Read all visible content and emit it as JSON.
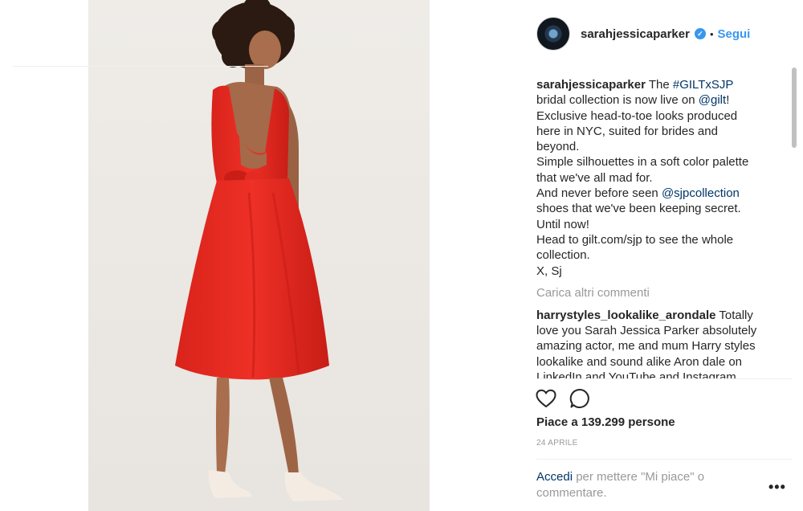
{
  "post": {
    "username": "sarahjessicaparker",
    "verified_mark": "✓",
    "separator": "•",
    "follow_label": "Segui",
    "image_icon": "photo-of-woman-in-red-dress"
  },
  "caption": {
    "username": "sarahjessicaparker",
    "lines": {
      "l1_pre": "The ",
      "hashtag": "#GILTxSJP",
      "l2_pre": "bridal collection is now live on ",
      "mention_gilt": "@gilt",
      "l2_post": "!",
      "l3": "Exclusive head-to-toe looks produced",
      "l4": "here in NYC, suited for brides and",
      "l5": "beyond.",
      "l6": "Simple silhouettes in a soft color palette",
      "l7": "that we've all mad for.",
      "l8_pre": "And never before seen ",
      "mention_sjp": "@sjpcollection",
      "l9": "shoes that we've been keeping secret.",
      "l10": "Until now!",
      "l11": "Head to gilt.com/sjp to see the whole",
      "l12": "collection.",
      "l13": "X, Sj"
    }
  },
  "load_more_label": "Carica altri commenti",
  "comment": {
    "username": "harrystyles_lookalike_arondale",
    "l1": "Totally",
    "l2": "love you Sarah Jessica Parker absolutely",
    "l3": "amazing actor, me and mum Harry styles",
    "l4": "lookalike and sound alike Aron dale on",
    "l5": "LinkedIn and YouTube and Instagram"
  },
  "actions": {
    "like_icon": "heart-icon",
    "comment_icon": "comment-icon"
  },
  "likes_text": "Piace a 139.299 persone",
  "date_text": "24 APRILE",
  "login": {
    "link": "Accedi",
    "rest_line1": " per mettere \"Mi piace\" o",
    "rest_line2": "commentare."
  },
  "more_label": "•••",
  "colors": {
    "link_blue": "#003569",
    "follow_blue": "#3897f0",
    "muted_gray": "#999999",
    "dress_red": "#e52a22"
  }
}
